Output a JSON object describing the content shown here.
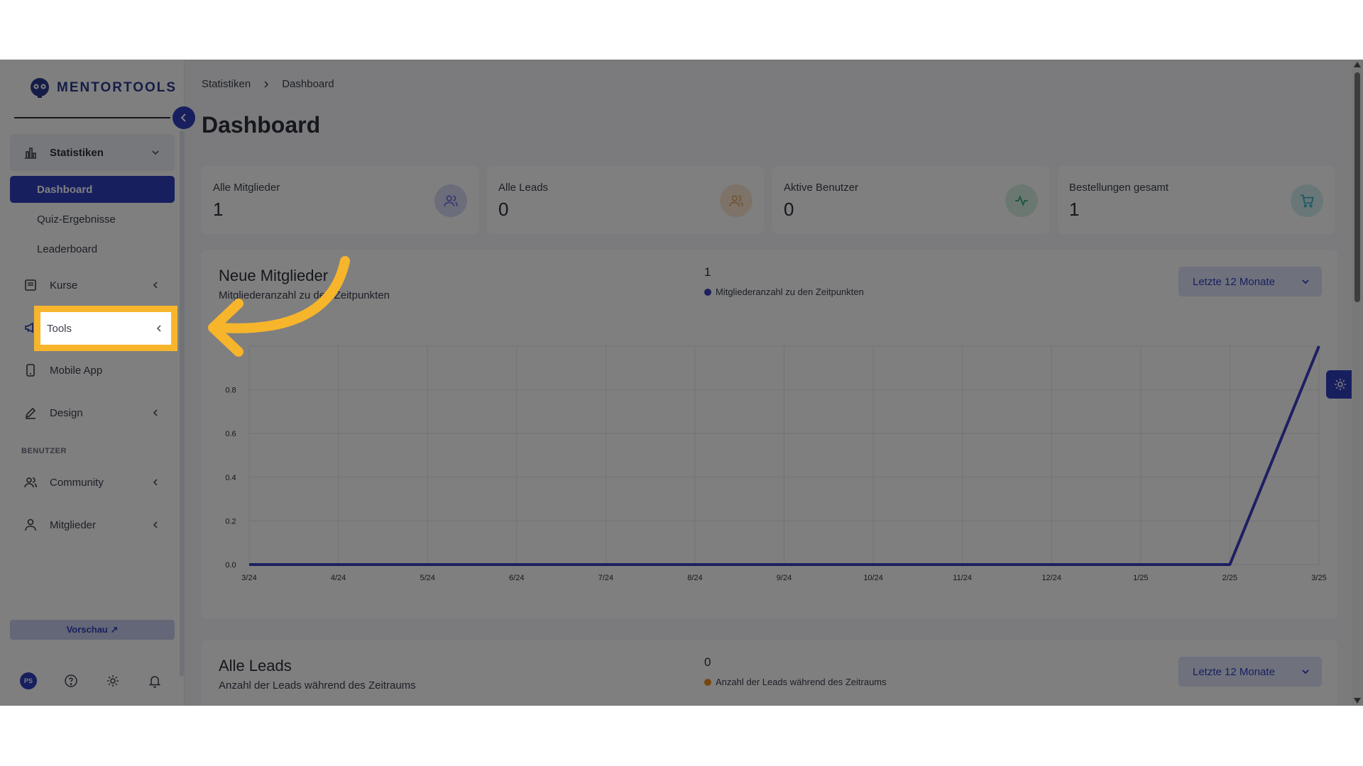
{
  "brand": {
    "name": "MENTORTOOLS"
  },
  "sidebar": {
    "statistiken": "Statistiken",
    "dashboard": "Dashboard",
    "quiz": "Quiz-Ergebnisse",
    "leaderboard": "Leaderboard",
    "kurse": "Kurse",
    "tools": "Tools",
    "mobile_app": "Mobile App",
    "design": "Design",
    "section_benutzer": "BENUTZER",
    "community": "Community",
    "mitglieder": "Mitglieder",
    "preview": "Vorschau ↗",
    "avatar_initials": "PS"
  },
  "breadcrumb": {
    "parent": "Statistiken",
    "current": "Dashboard"
  },
  "page": {
    "title": "Dashboard"
  },
  "stats": [
    {
      "label": "Alle Mitglieder",
      "value": "1",
      "icon": "users-icon",
      "color": "#6f74d8"
    },
    {
      "label": "Alle Leads",
      "value": "0",
      "icon": "users-icon",
      "color": "#e6a86a"
    },
    {
      "label": "Aktive Benutzer",
      "value": "0",
      "icon": "activity-icon",
      "color": "#3fb27a"
    },
    {
      "label": "Bestellungen gesamt",
      "value": "1",
      "icon": "cart-icon",
      "color": "#3ab0c2"
    }
  ],
  "panel_members": {
    "title": "Neue Mitglieder",
    "subtitle": "Mitgliederanzahl zu den Zeitpunkten",
    "value": "1",
    "legend": "Mitgliederanzahl zu den Zeitpunkten",
    "range": "Letzte 12 Monate"
  },
  "panel_leads": {
    "title": "Alle Leads",
    "subtitle": "Anzahl der Leads während des Zeitraums",
    "value": "0",
    "legend": "Anzahl der Leads während des Zeitraums",
    "range": "Letzte 12 Monate"
  },
  "colors": {
    "accent": "#2f3fbf",
    "line": "#3b41c2",
    "highlight": "#f7b52c",
    "leads_dot": "#f08c1c"
  },
  "chart_data": {
    "type": "line",
    "categories": [
      "3/24",
      "4/24",
      "5/24",
      "6/24",
      "7/24",
      "8/24",
      "9/24",
      "10/24",
      "11/24",
      "12/24",
      "1/25",
      "2/25",
      "3/25"
    ],
    "series": [
      {
        "name": "Mitgliederanzahl zu den Zeitpunkten",
        "values": [
          0,
          0,
          0,
          0,
          0,
          0,
          0,
          0,
          0,
          0,
          0,
          0,
          1
        ]
      }
    ],
    "ylim": [
      0,
      1
    ],
    "yticks": [
      "0.0",
      "0.2",
      "0.4",
      "0.6",
      "0.8"
    ],
    "grid": true,
    "legend": "top-center"
  }
}
